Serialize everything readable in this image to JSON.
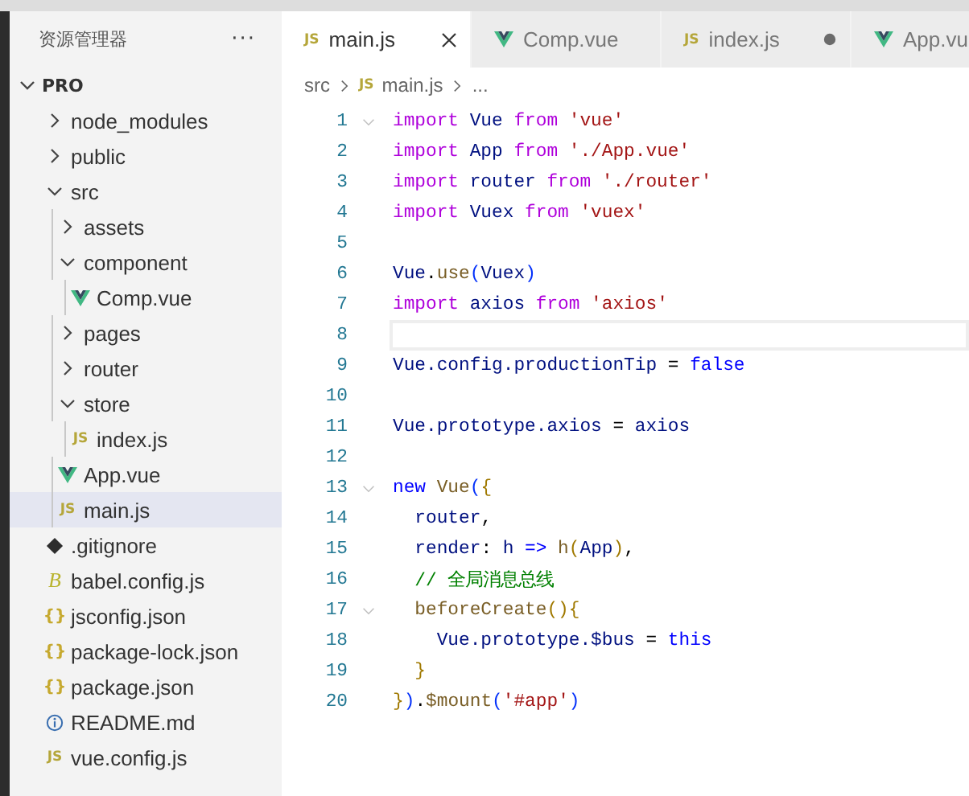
{
  "sidebar": {
    "title": "资源管理器",
    "more": "···",
    "project": {
      "name": "PRO",
      "expanded": true
    },
    "items": [
      {
        "name": "node_modules",
        "kind": "folder",
        "expanded": false,
        "selected": false
      },
      {
        "name": "public",
        "kind": "folder",
        "expanded": false,
        "selected": false
      },
      {
        "name": "src",
        "kind": "folder",
        "expanded": true,
        "selected": false,
        "children": [
          {
            "name": "assets",
            "kind": "folder",
            "expanded": false,
            "selected": false
          },
          {
            "name": "component",
            "kind": "folder",
            "expanded": true,
            "selected": false,
            "children": [
              {
                "name": "Comp.vue",
                "kind": "vue",
                "selected": false
              }
            ]
          },
          {
            "name": "pages",
            "kind": "folder",
            "expanded": false,
            "selected": false
          },
          {
            "name": "router",
            "kind": "folder",
            "expanded": false,
            "selected": false
          },
          {
            "name": "store",
            "kind": "folder",
            "expanded": true,
            "selected": false,
            "children": [
              {
                "name": "index.js",
                "kind": "js",
                "icon_label": "JS",
                "selected": false
              }
            ]
          },
          {
            "name": "App.vue",
            "kind": "vue",
            "selected": false
          },
          {
            "name": "main.js",
            "kind": "js",
            "icon_label": "JS",
            "selected": true
          }
        ]
      },
      {
        "name": ".gitignore",
        "kind": "git",
        "selected": false
      },
      {
        "name": "babel.config.js",
        "kind": "babel",
        "icon_label": "B",
        "selected": false
      },
      {
        "name": "jsconfig.json",
        "kind": "json",
        "icon_label": "{}",
        "selected": false
      },
      {
        "name": "package-lock.json",
        "kind": "json",
        "icon_label": "{}",
        "selected": false
      },
      {
        "name": "package.json",
        "kind": "json",
        "icon_label": "{}",
        "selected": false
      },
      {
        "name": "README.md",
        "kind": "info",
        "selected": false
      },
      {
        "name": "vue.config.js",
        "kind": "js",
        "icon_label": "JS",
        "selected": false
      }
    ]
  },
  "tabs": [
    {
      "label": "main.js",
      "kind": "js",
      "icon_label": "JS",
      "selected": true,
      "closable": true,
      "dirty": false
    },
    {
      "label": "Comp.vue",
      "kind": "vue",
      "selected": false,
      "closable": false,
      "dirty": false
    },
    {
      "label": "index.js",
      "kind": "js",
      "icon_label": "JS",
      "selected": false,
      "closable": false,
      "dirty": true
    },
    {
      "label": "App.vu",
      "kind": "vue",
      "selected": false
    }
  ],
  "breadcrumb": [
    {
      "label": "src"
    },
    {
      "label": "main.js",
      "kind": "js",
      "icon_label": "JS"
    },
    {
      "label": "..."
    }
  ],
  "code": [
    {
      "number": "1",
      "foldable": true,
      "tokens": [
        {
          "text": "import",
          "kind": "keyword"
        },
        {
          "text": " Vue ",
          "kind": "variable"
        },
        {
          "text": "from",
          "kind": "keyword"
        },
        {
          "text": " 'vue'",
          "kind": "string"
        }
      ]
    },
    {
      "number": "2",
      "tokens": [
        {
          "text": "import",
          "kind": "keyword"
        },
        {
          "text": " App ",
          "kind": "variable"
        },
        {
          "text": "from",
          "kind": "keyword"
        },
        {
          "text": " './App.vue'",
          "kind": "string"
        }
      ]
    },
    {
      "number": "3",
      "tokens": [
        {
          "text": "import",
          "kind": "keyword"
        },
        {
          "text": " router ",
          "kind": "variable"
        },
        {
          "text": "from",
          "kind": "keyword"
        },
        {
          "text": " './router'",
          "kind": "string"
        }
      ]
    },
    {
      "number": "4",
      "tokens": [
        {
          "text": "import",
          "kind": "keyword"
        },
        {
          "text": " Vuex ",
          "kind": "variable"
        },
        {
          "text": "from",
          "kind": "keyword"
        },
        {
          "text": " 'vuex'",
          "kind": "string"
        }
      ]
    },
    {
      "number": "5"
    },
    {
      "number": "6",
      "tokens": [
        {
          "text": "Vue",
          "kind": "variable"
        },
        {
          "text": ".",
          "kind": "operator"
        },
        {
          "text": "use",
          "kind": "function"
        },
        {
          "text": "(",
          "kind": "bracket"
        },
        {
          "text": "Vuex",
          "kind": "variable"
        },
        {
          "text": ")",
          "kind": "bracket"
        }
      ]
    },
    {
      "number": "7",
      "tokens": [
        {
          "text": "import",
          "kind": "keyword"
        },
        {
          "text": " axios ",
          "kind": "variable"
        },
        {
          "text": "from",
          "kind": "keyword"
        },
        {
          "text": " 'axios'",
          "kind": "string"
        }
      ]
    },
    {
      "number": "8",
      "current": true
    },
    {
      "number": "9",
      "tokens": [
        {
          "text": "Vue.config.productionTip",
          "kind": "variable"
        },
        {
          "text": " = ",
          "kind": "operator"
        },
        {
          "text": "false",
          "kind": "constant"
        }
      ]
    },
    {
      "number": "10"
    },
    {
      "number": "11",
      "tokens": [
        {
          "text": "Vue.prototype.axios",
          "kind": "variable"
        },
        {
          "text": " = ",
          "kind": "operator"
        },
        {
          "text": "axios",
          "kind": "variable"
        }
      ]
    },
    {
      "number": "12"
    },
    {
      "number": "13",
      "foldable": true,
      "tokens": [
        {
          "text": "new",
          "kind": "constant"
        },
        {
          "text": " Vue",
          "kind": "function"
        },
        {
          "text": "(",
          "kind": "bracket"
        },
        {
          "text": "{",
          "kind": "brace"
        }
      ]
    },
    {
      "number": "14",
      "tokens": [
        {
          "text": "  router",
          "kind": "variable"
        },
        {
          "text": ",",
          "kind": "operator"
        }
      ]
    },
    {
      "number": "15",
      "tokens": [
        {
          "text": "  render",
          "kind": "variable"
        },
        {
          "text": ": ",
          "kind": "operator"
        },
        {
          "text": "h",
          "kind": "variable"
        },
        {
          "text": " => ",
          "kind": "constant"
        },
        {
          "text": "h",
          "kind": "function"
        },
        {
          "text": "(",
          "kind": "brace"
        },
        {
          "text": "App",
          "kind": "variable"
        },
        {
          "text": ")",
          "kind": "brace"
        },
        {
          "text": ",",
          "kind": "operator"
        }
      ]
    },
    {
      "number": "16",
      "tokens": [
        {
          "text": "  // 全局消息总线",
          "kind": "comment"
        }
      ]
    },
    {
      "number": "17",
      "foldable": true,
      "tokens": [
        {
          "text": "  beforeCreate",
          "kind": "function"
        },
        {
          "text": "(){",
          "kind": "brace"
        }
      ]
    },
    {
      "number": "18",
      "tokens": [
        {
          "text": "    Vue.prototype.$bus",
          "kind": "variable"
        },
        {
          "text": " = ",
          "kind": "operator"
        },
        {
          "text": "this",
          "kind": "constant"
        }
      ]
    },
    {
      "number": "19",
      "tokens": [
        {
          "text": "  }",
          "kind": "brace"
        }
      ]
    },
    {
      "number": "20",
      "tokens": [
        {
          "text": "}",
          "kind": "brace"
        },
        {
          "text": ")",
          "kind": "bracket"
        },
        {
          "text": ".",
          "kind": "operator"
        },
        {
          "text": "$mount",
          "kind": "function"
        },
        {
          "text": "(",
          "kind": "bracket"
        },
        {
          "text": "'#app'",
          "kind": "string"
        },
        {
          "text": ")",
          "kind": "bracket"
        }
      ]
    }
  ]
}
